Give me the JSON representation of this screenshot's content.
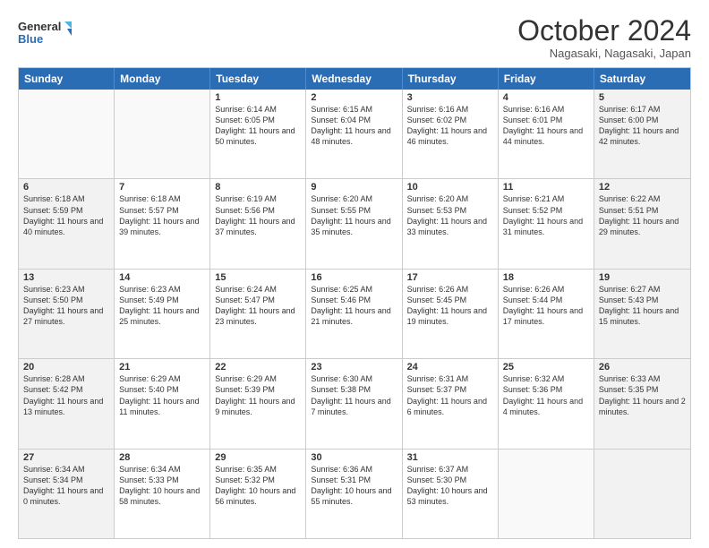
{
  "header": {
    "logo_line1": "General",
    "logo_line2": "Blue",
    "month": "October 2024",
    "location": "Nagasaki, Nagasaki, Japan"
  },
  "weekdays": [
    "Sunday",
    "Monday",
    "Tuesday",
    "Wednesday",
    "Thursday",
    "Friday",
    "Saturday"
  ],
  "rows": [
    [
      {
        "day": "",
        "info": "",
        "empty": true
      },
      {
        "day": "",
        "info": "",
        "empty": true
      },
      {
        "day": "1",
        "info": "Sunrise: 6:14 AM\nSunset: 6:05 PM\nDaylight: 11 hours\nand 50 minutes."
      },
      {
        "day": "2",
        "info": "Sunrise: 6:15 AM\nSunset: 6:04 PM\nDaylight: 11 hours\nand 48 minutes."
      },
      {
        "day": "3",
        "info": "Sunrise: 6:16 AM\nSunset: 6:02 PM\nDaylight: 11 hours\nand 46 minutes."
      },
      {
        "day": "4",
        "info": "Sunrise: 6:16 AM\nSunset: 6:01 PM\nDaylight: 11 hours\nand 44 minutes."
      },
      {
        "day": "5",
        "info": "Sunrise: 6:17 AM\nSunset: 6:00 PM\nDaylight: 11 hours\nand 42 minutes.",
        "shaded": true
      }
    ],
    [
      {
        "day": "6",
        "info": "Sunrise: 6:18 AM\nSunset: 5:59 PM\nDaylight: 11 hours\nand 40 minutes.",
        "shaded": true
      },
      {
        "day": "7",
        "info": "Sunrise: 6:18 AM\nSunset: 5:57 PM\nDaylight: 11 hours\nand 39 minutes."
      },
      {
        "day": "8",
        "info": "Sunrise: 6:19 AM\nSunset: 5:56 PM\nDaylight: 11 hours\nand 37 minutes."
      },
      {
        "day": "9",
        "info": "Sunrise: 6:20 AM\nSunset: 5:55 PM\nDaylight: 11 hours\nand 35 minutes."
      },
      {
        "day": "10",
        "info": "Sunrise: 6:20 AM\nSunset: 5:53 PM\nDaylight: 11 hours\nand 33 minutes."
      },
      {
        "day": "11",
        "info": "Sunrise: 6:21 AM\nSunset: 5:52 PM\nDaylight: 11 hours\nand 31 minutes."
      },
      {
        "day": "12",
        "info": "Sunrise: 6:22 AM\nSunset: 5:51 PM\nDaylight: 11 hours\nand 29 minutes.",
        "shaded": true
      }
    ],
    [
      {
        "day": "13",
        "info": "Sunrise: 6:23 AM\nSunset: 5:50 PM\nDaylight: 11 hours\nand 27 minutes.",
        "shaded": true
      },
      {
        "day": "14",
        "info": "Sunrise: 6:23 AM\nSunset: 5:49 PM\nDaylight: 11 hours\nand 25 minutes."
      },
      {
        "day": "15",
        "info": "Sunrise: 6:24 AM\nSunset: 5:47 PM\nDaylight: 11 hours\nand 23 minutes."
      },
      {
        "day": "16",
        "info": "Sunrise: 6:25 AM\nSunset: 5:46 PM\nDaylight: 11 hours\nand 21 minutes."
      },
      {
        "day": "17",
        "info": "Sunrise: 6:26 AM\nSunset: 5:45 PM\nDaylight: 11 hours\nand 19 minutes."
      },
      {
        "day": "18",
        "info": "Sunrise: 6:26 AM\nSunset: 5:44 PM\nDaylight: 11 hours\nand 17 minutes."
      },
      {
        "day": "19",
        "info": "Sunrise: 6:27 AM\nSunset: 5:43 PM\nDaylight: 11 hours\nand 15 minutes.",
        "shaded": true
      }
    ],
    [
      {
        "day": "20",
        "info": "Sunrise: 6:28 AM\nSunset: 5:42 PM\nDaylight: 11 hours\nand 13 minutes.",
        "shaded": true
      },
      {
        "day": "21",
        "info": "Sunrise: 6:29 AM\nSunset: 5:40 PM\nDaylight: 11 hours\nand 11 minutes."
      },
      {
        "day": "22",
        "info": "Sunrise: 6:29 AM\nSunset: 5:39 PM\nDaylight: 11 hours\nand 9 minutes."
      },
      {
        "day": "23",
        "info": "Sunrise: 6:30 AM\nSunset: 5:38 PM\nDaylight: 11 hours\nand 7 minutes."
      },
      {
        "day": "24",
        "info": "Sunrise: 6:31 AM\nSunset: 5:37 PM\nDaylight: 11 hours\nand 6 minutes."
      },
      {
        "day": "25",
        "info": "Sunrise: 6:32 AM\nSunset: 5:36 PM\nDaylight: 11 hours\nand 4 minutes."
      },
      {
        "day": "26",
        "info": "Sunrise: 6:33 AM\nSunset: 5:35 PM\nDaylight: 11 hours\nand 2 minutes.",
        "shaded": true
      }
    ],
    [
      {
        "day": "27",
        "info": "Sunrise: 6:34 AM\nSunset: 5:34 PM\nDaylight: 11 hours\nand 0 minutes.",
        "shaded": true
      },
      {
        "day": "28",
        "info": "Sunrise: 6:34 AM\nSunset: 5:33 PM\nDaylight: 10 hours\nand 58 minutes."
      },
      {
        "day": "29",
        "info": "Sunrise: 6:35 AM\nSunset: 5:32 PM\nDaylight: 10 hours\nand 56 minutes."
      },
      {
        "day": "30",
        "info": "Sunrise: 6:36 AM\nSunset: 5:31 PM\nDaylight: 10 hours\nand 55 minutes."
      },
      {
        "day": "31",
        "info": "Sunrise: 6:37 AM\nSunset: 5:30 PM\nDaylight: 10 hours\nand 53 minutes."
      },
      {
        "day": "",
        "info": "",
        "empty": true
      },
      {
        "day": "",
        "info": "",
        "empty": true,
        "shaded": true
      }
    ]
  ]
}
